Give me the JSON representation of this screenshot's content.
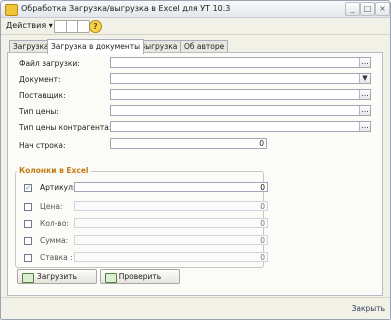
{
  "window": {
    "title": "Обработка  Загрузка/выгрузка в Excel для УТ 10.3",
    "controls": [
      "_",
      "□",
      "×"
    ]
  },
  "toolbar": {
    "actions_label": "Действия ▾",
    "icons": [
      "table-icon",
      "document-icon",
      "search-document-icon",
      "help-icon"
    ],
    "help_symbol": "?"
  },
  "tabs": [
    "Загрузка",
    "Загрузка в документы",
    "Выгрузка",
    "Об авторе"
  ],
  "form": {
    "file_label": "Файл загрузки:",
    "document_label": "Документ:",
    "supplier_label": "Поставщик:",
    "price_type_label": "Тип цены:",
    "contractor_price_type_label": "Тип цены контрагента:",
    "start_row_label": "Нач строка:",
    "start_row_value": "0",
    "dots": "...",
    "dropdown": "▼"
  },
  "excel_columns": {
    "title": "Колонки в Excel",
    "rows": [
      {
        "label": "Артикул:",
        "value": "0",
        "checked": true,
        "enabled": true
      },
      {
        "label": "Цена:",
        "value": "0",
        "checked": false,
        "enabled": false
      },
      {
        "label": "Кол-во:",
        "value": "0",
        "checked": false,
        "enabled": false
      },
      {
        "label": "Сумма:",
        "value": "0",
        "checked": false,
        "enabled": false
      },
      {
        "label": "Ставка :",
        "value": "0",
        "checked": false,
        "enabled": false
      }
    ]
  },
  "buttons": {
    "load": "Загрузить",
    "check": "Проверить"
  },
  "footer": {
    "close": "Закрыть"
  }
}
